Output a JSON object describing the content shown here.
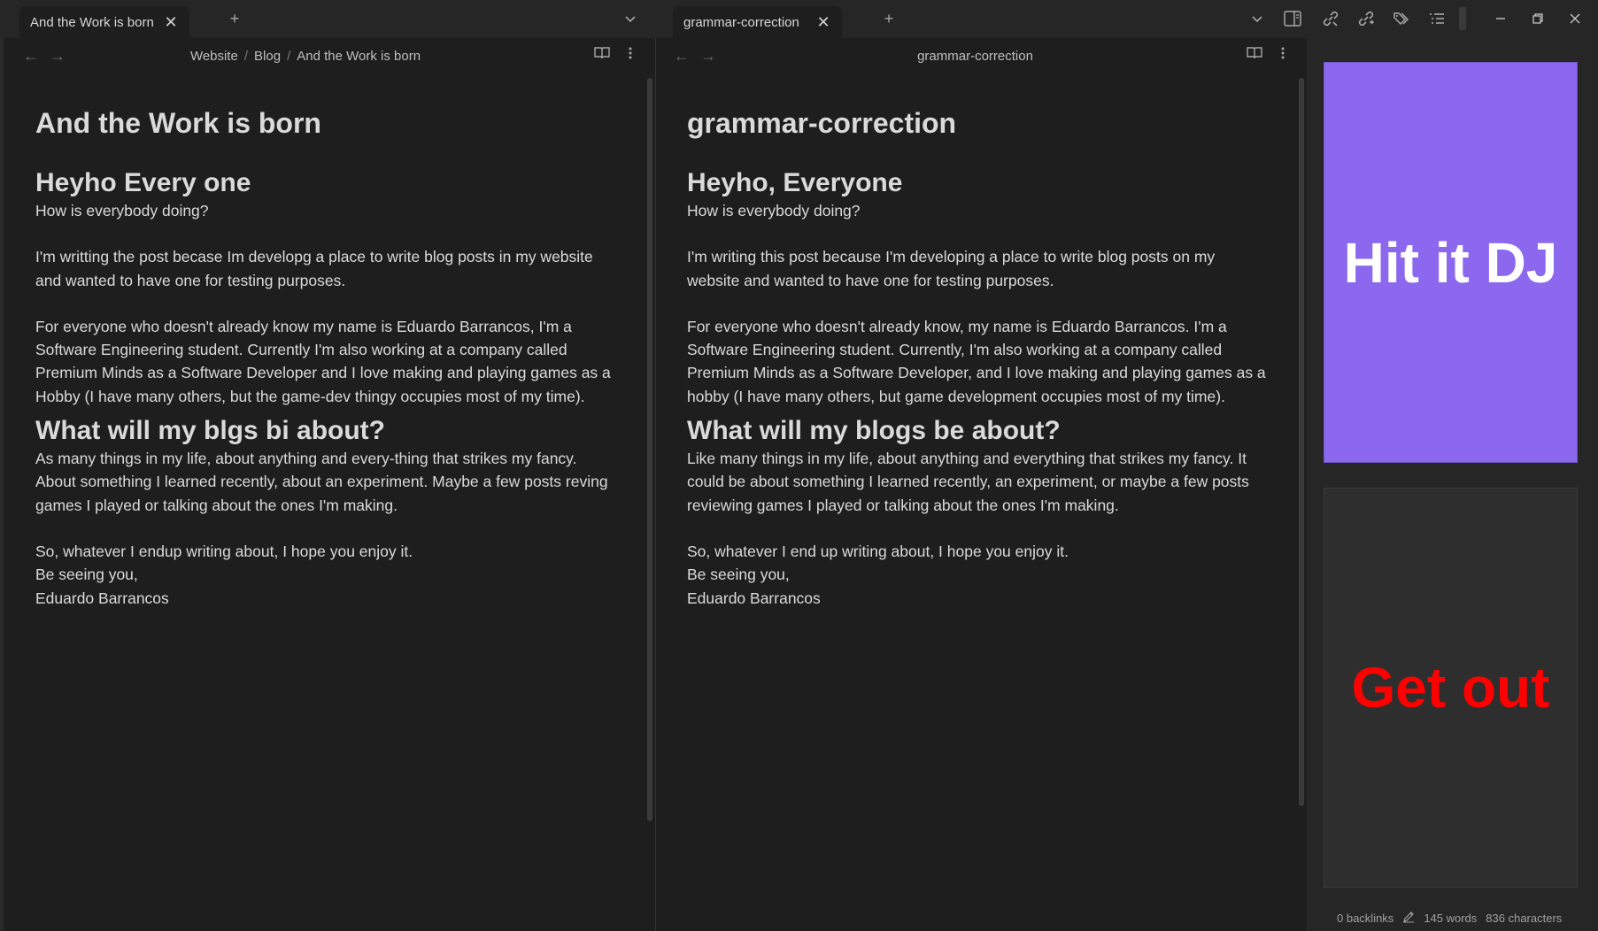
{
  "tabs_left": {
    "tab_title": "And the Work is born",
    "close": "✕",
    "new_tab": "+",
    "dropdown": "⌄"
  },
  "tabs_right": {
    "tab_title": "grammar-correction",
    "close": "✕",
    "new_tab": "+",
    "dropdown": "⌄"
  },
  "left_pane": {
    "breadcrumb": [
      "Website",
      "Blog",
      "And the Work is born"
    ],
    "title": "And the Work is born",
    "heading1": "Heyho Every one",
    "line1": "How is everybody doing?",
    "para1": "I'm writting the post becase Im developg a place to write blog posts in my website and wanted to have one for testing purposes.",
    "para2": "For everyone who doesn't already know my name is Eduardo Barrancos, I'm a Software Engineering student. Currently I'm also working at a company called Premium Minds as a Software Developer and I love making and playing games as a Hobby (I have many others, but the game-dev thingy occupies most of my time).",
    "heading2": "What will my blgs bi about?",
    "para3": "As many things in my life, about anything and every-thing that strikes my fancy. About something I learned recently, about an experiment. Maybe a few posts reving games I played or talking about the ones I'm making.",
    "closing1": "So, whatever I endup writing about, I hope you enjoy it.",
    "closing2": "Be seeing you,",
    "closing3": "Eduardo Barrancos"
  },
  "right_pane": {
    "header_title": "grammar-correction",
    "title": "grammar-correction",
    "heading1": "Heyho, Everyone",
    "line1": "How is everybody doing?",
    "para1": "I'm writing this post because I'm developing a place to write blog posts on my website and wanted to have one for testing purposes.",
    "para2": "For everyone who doesn't already know, my name is Eduardo Barrancos. I'm a Software Engineering student. Currently, I'm also working at a company called Premium Minds as a Software Developer, and I love making and playing games as a hobby (I have many others, but game development occupies most of my time).",
    "heading2": "What will my blogs be about?",
    "para3": "Like many things in my life, about anything and everything that strikes my fancy. It could be about something I learned recently, an experiment, or maybe a few posts reviewing games I played or talking about the ones I'm making.",
    "closing1": "So, whatever I end up writing about, I hope you enjoy it.",
    "closing2": "Be seeing you,",
    "closing3": "Eduardo Barrancos"
  },
  "sidebar": {
    "card1_text": "Hit it DJ",
    "card2_text": "Get out",
    "card1_color": "#8b68ee",
    "card2_text_color": "#ff0000"
  },
  "status": {
    "backlinks": "0 backlinks",
    "words": "145 words",
    "characters": "836 characters"
  }
}
